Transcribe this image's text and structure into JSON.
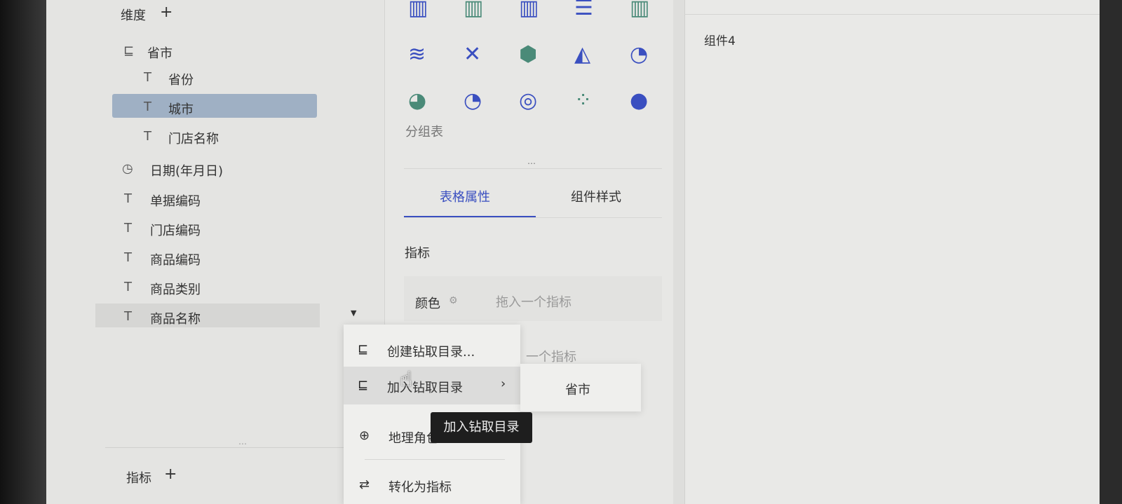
{
  "dimension": {
    "title": "维度",
    "add": "+",
    "items": [
      {
        "label": "省市",
        "icon": "hierarchy-icon"
      },
      {
        "label": "省份",
        "icon": "text-type-icon"
      },
      {
        "label": "城市",
        "icon": "text-type-icon"
      },
      {
        "label": "门店名称",
        "icon": "text-type-icon"
      },
      {
        "label": "日期(年月日)",
        "icon": "clock-icon"
      },
      {
        "label": "单据编码",
        "icon": "text-type-icon"
      },
      {
        "label": "门店编码",
        "icon": "text-type-icon"
      },
      {
        "label": "商品编码",
        "icon": "text-type-icon"
      },
      {
        "label": "商品类别",
        "icon": "text-type-icon"
      },
      {
        "label": "商品名称",
        "icon": "text-type-icon"
      }
    ]
  },
  "metric": {
    "title": "指标",
    "add": "+"
  },
  "chart_panel": {
    "selected_label": "分组表"
  },
  "tabs": [
    {
      "label": "表格属性"
    },
    {
      "label": "组件样式"
    }
  ],
  "props": {
    "section": "指标",
    "color_label": "颜色",
    "drop_hint": "拖入一个指标",
    "drop_hint2": "一个指标"
  },
  "context_menu": {
    "items": [
      {
        "label": "创建钻取目录..."
      },
      {
        "label": "加入钻取目录"
      },
      {
        "label": "地理角色"
      },
      {
        "label": "转化为指标"
      }
    ]
  },
  "submenu": {
    "items": [
      {
        "label": "省市"
      }
    ]
  },
  "tooltip": "加入钻取目录",
  "canvas": {
    "component": "组件4"
  },
  "colors": {
    "accent": "#3a4fc0",
    "selected": "#9fb0c4"
  }
}
